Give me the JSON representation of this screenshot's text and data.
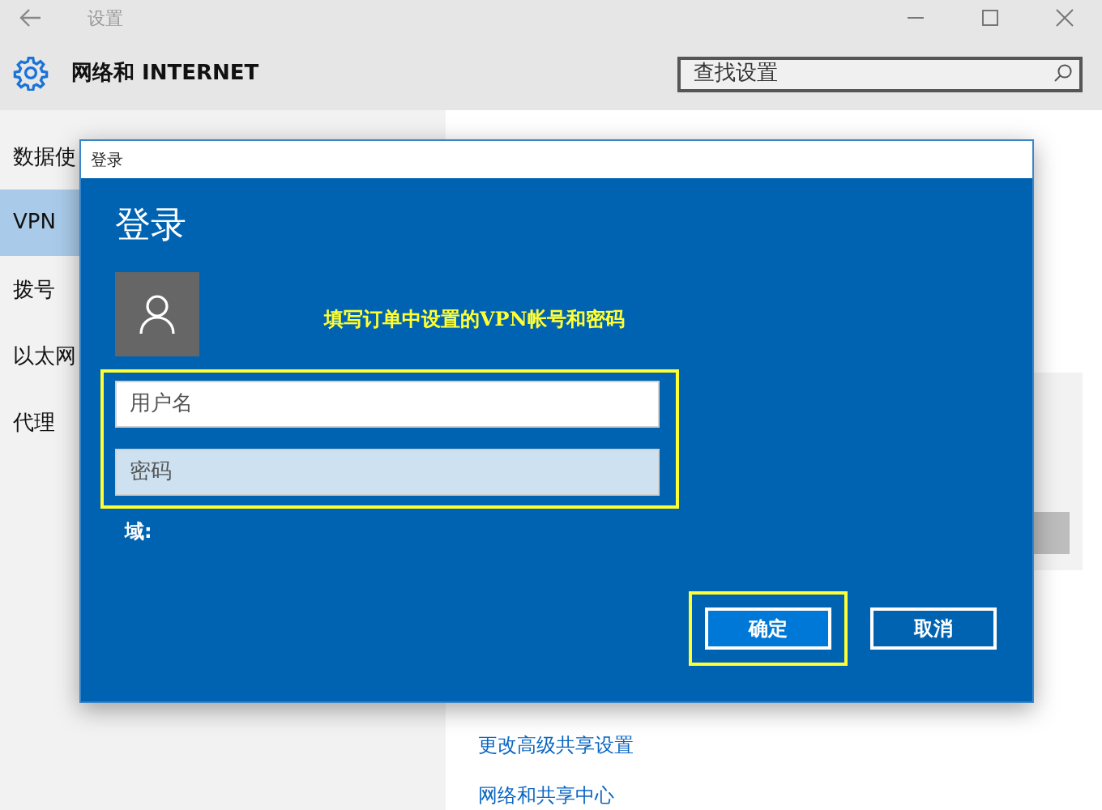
{
  "window": {
    "title": "设置"
  },
  "header": {
    "title": "网络和 INTERNET",
    "search": {
      "placeholder": "查找设置"
    }
  },
  "sidebar": {
    "items": [
      {
        "label": "数据使",
        "selected": false
      },
      {
        "label": "VPN",
        "selected": true
      },
      {
        "label": "拨号",
        "selected": false
      },
      {
        "label": "以太网",
        "selected": false
      },
      {
        "label": "代理",
        "selected": false
      }
    ]
  },
  "content": {
    "links": [
      "更改高级共享设置",
      "网络和共享中心"
    ]
  },
  "dialog": {
    "window_title": "登录",
    "heading": "登录",
    "annotation": "填写订单中设置的VPN帐号和密码",
    "username": {
      "placeholder": "用户名"
    },
    "password": {
      "placeholder": "密码"
    },
    "domain_label": "域:",
    "buttons": [
      {
        "label": "确定",
        "kind": "primary",
        "highlighted": true
      },
      {
        "label": "取消",
        "kind": "secondary",
        "highlighted": false
      }
    ]
  }
}
